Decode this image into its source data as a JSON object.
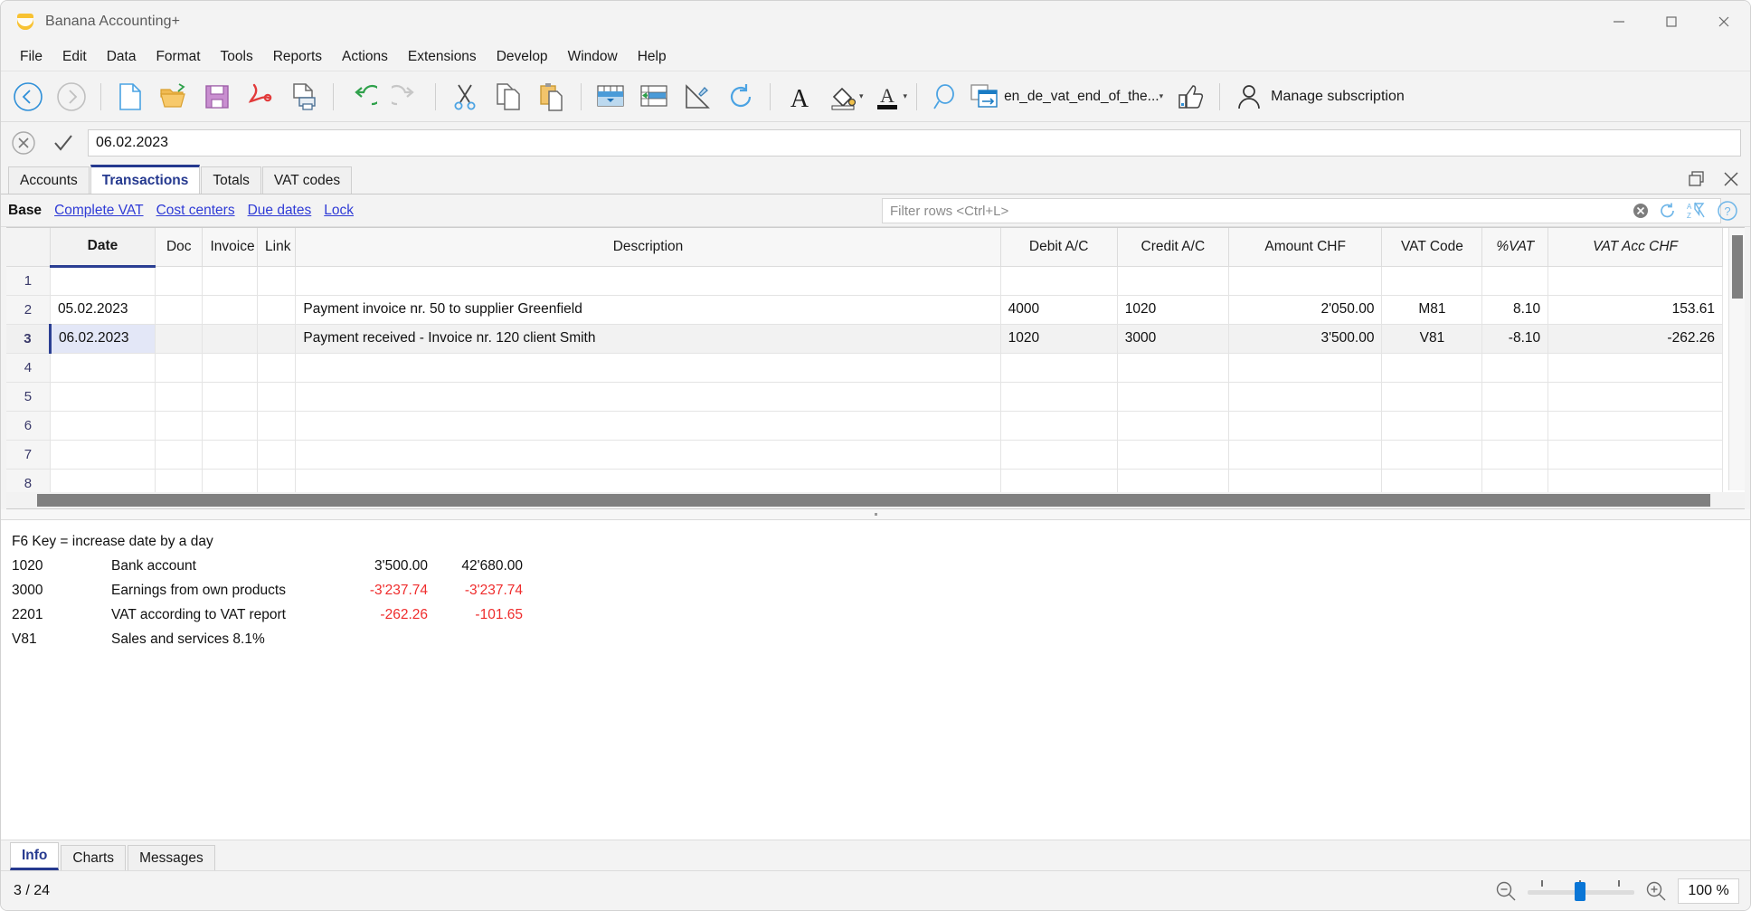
{
  "window": {
    "title": "Banana Accounting+",
    "app_icon": "banana-logo-icon",
    "minimize_label": "—",
    "maximize_label": "□",
    "close_label": "✕"
  },
  "menubar": {
    "items": [
      {
        "label": "File"
      },
      {
        "label": "Edit"
      },
      {
        "label": "Data"
      },
      {
        "label": "Format"
      },
      {
        "label": "Tools"
      },
      {
        "label": "Reports"
      },
      {
        "label": "Actions"
      },
      {
        "label": "Extensions"
      },
      {
        "label": "Develop"
      },
      {
        "label": "Window"
      },
      {
        "label": "Help"
      }
    ]
  },
  "toolbar": {
    "buttons": [
      {
        "name": "back-icon",
        "title": "Back"
      },
      {
        "name": "forward-icon",
        "title": "Forward"
      },
      {
        "name": "new-file-icon",
        "title": "New"
      },
      {
        "name": "open-folder-icon",
        "title": "Open"
      },
      {
        "name": "save-floppy-icon",
        "title": "Save"
      },
      {
        "name": "pdf-export-icon",
        "title": "Create PDF"
      },
      {
        "name": "print-preview-icon",
        "title": "Print preview"
      },
      {
        "name": "undo-icon",
        "title": "Undo"
      },
      {
        "name": "redo-icon",
        "title": "Redo"
      },
      {
        "name": "cut-scissors-icon",
        "title": "Cut"
      },
      {
        "name": "copy-icon",
        "title": "Copy"
      },
      {
        "name": "paste-icon",
        "title": "Paste"
      },
      {
        "name": "add-row-icon",
        "title": "Add rows"
      },
      {
        "name": "insert-row-icon",
        "title": "Insert rows"
      },
      {
        "name": "protect-row-icon",
        "title": "Protect"
      },
      {
        "name": "refresh-icon",
        "title": "Recalculate"
      },
      {
        "name": "font-style-icon",
        "title": "Character font"
      },
      {
        "name": "fill-color-icon",
        "title": "Background color"
      },
      {
        "name": "text-color-icon",
        "title": "Text color"
      },
      {
        "name": "search-icon",
        "title": "Find"
      }
    ],
    "document_chip": {
      "icon": "window-switch-icon",
      "label": "en_de_vat_end_of_the...",
      "caret": "▾"
    },
    "thumbs_up": {
      "icon": "thumbs-up-icon"
    },
    "subscription": {
      "icon": "user-account-icon",
      "label": "Manage subscription"
    }
  },
  "formulabar": {
    "cancel_icon": "cancel-circle-icon",
    "accept_icon": "checkmark-icon",
    "value": "06.02.2023",
    "placeholder": ""
  },
  "doc_tabs": {
    "items": [
      {
        "label": "Accounts",
        "active": false
      },
      {
        "label": "Transactions",
        "active": true
      },
      {
        "label": "Totals",
        "active": false
      },
      {
        "label": "VAT codes",
        "active": false
      }
    ],
    "right_buttons": [
      {
        "name": "restore-pane-icon"
      },
      {
        "name": "close-pane-icon"
      }
    ]
  },
  "viewbar": {
    "base_label": "Base",
    "links": [
      {
        "label": "Complete VAT"
      },
      {
        "label": "Cost centers"
      },
      {
        "label": "Due dates"
      },
      {
        "label": "Lock"
      }
    ],
    "filter": {
      "placeholder": "Filter rows <Ctrl+L>",
      "value": "",
      "clear_icon": "clear-circle-icon",
      "reload_icon": "refresh-filter-icon",
      "sort_icon": "sort-az-icon",
      "help_icon": "help-circle-icon"
    }
  },
  "table": {
    "columns": [
      {
        "key": "rownum",
        "label": "",
        "align": "center",
        "active": false,
        "italic": false
      },
      {
        "key": "date",
        "label": "Date",
        "align": "left",
        "active": true,
        "italic": false
      },
      {
        "key": "doc",
        "label": "Doc",
        "align": "left",
        "active": false,
        "italic": false
      },
      {
        "key": "invoice",
        "label": "Invoice",
        "align": "left",
        "active": false,
        "italic": false
      },
      {
        "key": "link",
        "label": "Link",
        "align": "left",
        "active": false,
        "italic": false
      },
      {
        "key": "description",
        "label": "Description",
        "align": "center",
        "active": false,
        "italic": false
      },
      {
        "key": "debit",
        "label": "Debit A/C",
        "align": "center",
        "active": false,
        "italic": false
      },
      {
        "key": "credit",
        "label": "Credit A/C",
        "align": "center",
        "active": false,
        "italic": false
      },
      {
        "key": "amount",
        "label": "Amount CHF",
        "align": "center",
        "active": false,
        "italic": false
      },
      {
        "key": "vatcode",
        "label": "VAT Code",
        "align": "center",
        "active": false,
        "italic": false
      },
      {
        "key": "vatpct",
        "label": "%VAT",
        "align": "center",
        "active": false,
        "italic": true
      },
      {
        "key": "vatacc",
        "label": "VAT Acc CHF",
        "align": "center",
        "active": false,
        "italic": true
      }
    ],
    "rows": [
      {
        "rownum": "1",
        "date": "",
        "doc": "",
        "invoice": "",
        "link": "",
        "description": "",
        "debit": "",
        "credit": "",
        "amount": "",
        "vatcode": "",
        "vatpct": "",
        "vatacc": "",
        "selected": false,
        "date_selected": false,
        "vatpct_negative": false,
        "vatacc_negative": false
      },
      {
        "rownum": "2",
        "date": "05.02.2023",
        "doc": "",
        "invoice": "",
        "link": "",
        "description": "Payment invoice nr. 50 to supplier Greenfield",
        "debit": "4000",
        "credit": "1020",
        "amount": "2'050.00",
        "vatcode": "M81",
        "vatpct": "8.10",
        "vatacc": "153.61",
        "selected": false,
        "date_selected": false,
        "vatpct_negative": false,
        "vatacc_negative": false
      },
      {
        "rownum": "3",
        "date": "06.02.2023",
        "doc": "",
        "invoice": "",
        "link": "",
        "description": "Payment received - Invoice nr. 120 client Smith",
        "debit": "1020",
        "credit": "3000",
        "amount": "3'500.00",
        "vatcode": "V81",
        "vatpct": "-8.10",
        "vatacc": "-262.26",
        "selected": true,
        "date_selected": true,
        "vatpct_negative": true,
        "vatacc_negative": true
      },
      {
        "rownum": "4",
        "date": "",
        "doc": "",
        "invoice": "",
        "link": "",
        "description": "",
        "debit": "",
        "credit": "",
        "amount": "",
        "vatcode": "",
        "vatpct": "",
        "vatacc": "",
        "selected": false,
        "date_selected": false,
        "vatpct_negative": false,
        "vatacc_negative": false
      },
      {
        "rownum": "5",
        "date": "",
        "doc": "",
        "invoice": "",
        "link": "",
        "description": "",
        "debit": "",
        "credit": "",
        "amount": "",
        "vatcode": "",
        "vatpct": "",
        "vatacc": "",
        "selected": false,
        "date_selected": false,
        "vatpct_negative": false,
        "vatacc_negative": false
      },
      {
        "rownum": "6",
        "date": "",
        "doc": "",
        "invoice": "",
        "link": "",
        "description": "",
        "debit": "",
        "credit": "",
        "amount": "",
        "vatcode": "",
        "vatpct": "",
        "vatacc": "",
        "selected": false,
        "date_selected": false,
        "vatpct_negative": false,
        "vatacc_negative": false
      },
      {
        "rownum": "7",
        "date": "",
        "doc": "",
        "invoice": "",
        "link": "",
        "description": "",
        "debit": "",
        "credit": "",
        "amount": "",
        "vatcode": "",
        "vatpct": "",
        "vatacc": "",
        "selected": false,
        "date_selected": false,
        "vatpct_negative": false,
        "vatacc_negative": false
      },
      {
        "rownum": "8",
        "date": "",
        "doc": "",
        "invoice": "",
        "link": "",
        "description": "",
        "debit": "",
        "credit": "",
        "amount": "",
        "vatcode": "",
        "vatpct": "",
        "vatacc": "",
        "selected": false,
        "date_selected": false,
        "vatpct_negative": false,
        "vatacc_negative": false
      }
    ]
  },
  "info_pane": {
    "hint": "F6 Key = increase date by a day",
    "lines": [
      {
        "code": "1020",
        "desc": "Bank account",
        "value1": "3'500.00",
        "value2": "42'680.00",
        "neg1": false,
        "neg2": false
      },
      {
        "code": "3000",
        "desc": "Earnings from own products",
        "value1": "-3'237.74",
        "value2": "-3'237.74",
        "neg1": true,
        "neg2": true
      },
      {
        "code": "2201",
        "desc": "VAT according to VAT report",
        "value1": "-262.26",
        "value2": "-101.65",
        "neg1": true,
        "neg2": true
      },
      {
        "code": "V81",
        "desc": "Sales and services 8.1%",
        "value1": "",
        "value2": "",
        "neg1": false,
        "neg2": false
      }
    ]
  },
  "bottom_tabs": {
    "items": [
      {
        "label": "Info",
        "active": true
      },
      {
        "label": "Charts",
        "active": false
      },
      {
        "label": "Messages",
        "active": false
      }
    ]
  },
  "statusbar": {
    "position": "3 / 24",
    "zoom_out_icon": "zoom-out-icon",
    "zoom_in_icon": "zoom-in-icon",
    "zoom_value": "100 %"
  },
  "colors": {
    "accent": "#25398f",
    "link": "#2f3bd6",
    "negative": "#e8262c",
    "slider": "#0a76d6",
    "brand_yellow": "#f8c231"
  }
}
